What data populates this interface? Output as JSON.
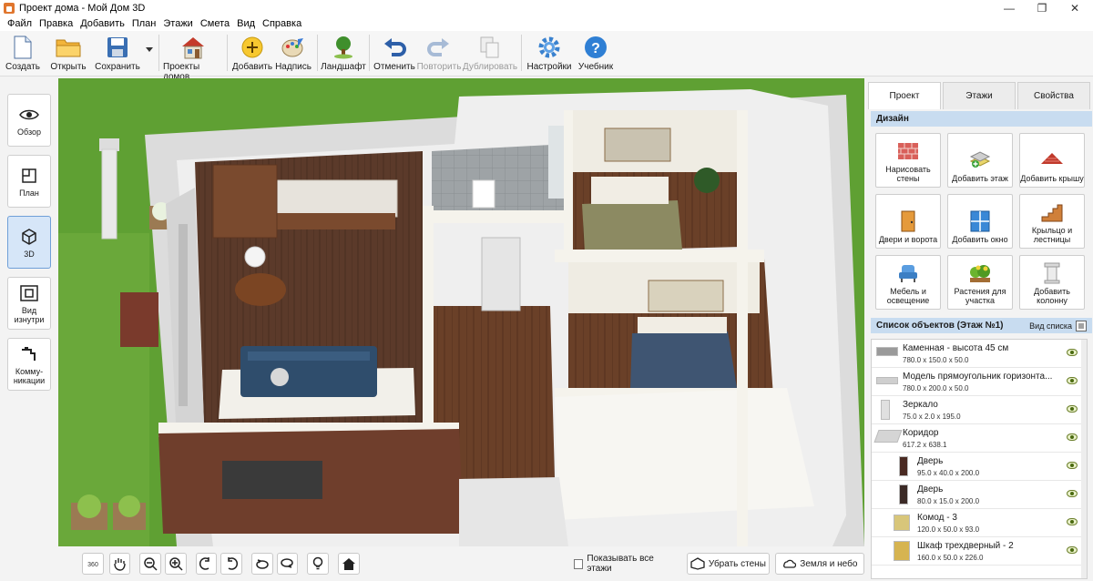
{
  "window": {
    "title": "Проект дома - Мой Дом 3D",
    "min": "—",
    "max": "❐",
    "close": "✕"
  },
  "menu": [
    "Файл",
    "Правка",
    "Добавить",
    "План",
    "Этажи",
    "Смета",
    "Вид",
    "Справка"
  ],
  "toolbar": {
    "create": "Создать",
    "open": "Открыть",
    "save": "Сохранить",
    "projects": "Проекты домов",
    "add": "Добавить",
    "caption": "Надпись",
    "landscape": "Ландшафт",
    "undo": "Отменить",
    "redo": "Повторить",
    "duplicate": "Дублировать",
    "settings": "Настройки",
    "tutorial": "Учебник"
  },
  "left_panel": {
    "overview": "Обзор",
    "plan": "План",
    "view3d": "3D",
    "inside": "Вид изнутри",
    "utilities": "Комму-никации"
  },
  "bottom_bar": {
    "show_all_floors": "Показывать все этажи",
    "remove_walls": "Убрать стены",
    "earth_sky": "Земля и небо"
  },
  "right_panel": {
    "tabs": [
      "Проект",
      "Этажи",
      "Свойства"
    ],
    "design_header": "Дизайн",
    "design_items": [
      "Нарисовать стены",
      "Добавить этаж",
      "Добавить крышу",
      "Двери и ворота",
      "Добавить окно",
      "Крыльцо и лестницы",
      "Мебель и освещение",
      "Растения для участка",
      "Добавить колонну"
    ],
    "objects_header": "Список объектов (Этаж №1)",
    "list_view": "Вид списка",
    "objects": [
      {
        "name": "Каменная - высота 45 см",
        "dims": "780.0 x 150.0 x 50.0"
      },
      {
        "name": "Модель прямоугольник горизонта...",
        "dims": "780.0 x 200.0 x 50.0"
      },
      {
        "name": "Зеркало",
        "dims": "75.0 x 2.0 x 195.0"
      },
      {
        "name": "Коридор",
        "dims": "617.2 x 638.1"
      },
      {
        "name": "Дверь",
        "dims": "95.0 x 40.0 x 200.0"
      },
      {
        "name": "Дверь",
        "dims": "80.0 x 15.0 x 200.0"
      },
      {
        "name": "Комод - 3",
        "dims": "120.0 x 50.0 x 93.0"
      },
      {
        "name": "Шкаф трехдверный - 2",
        "dims": "160.0 x 50.0 x 226.0"
      }
    ]
  },
  "colors": {
    "accent": "#c8dcf0",
    "grass": "#5fa033",
    "floor": "#5a3a28",
    "active": "#d6e6f8"
  }
}
